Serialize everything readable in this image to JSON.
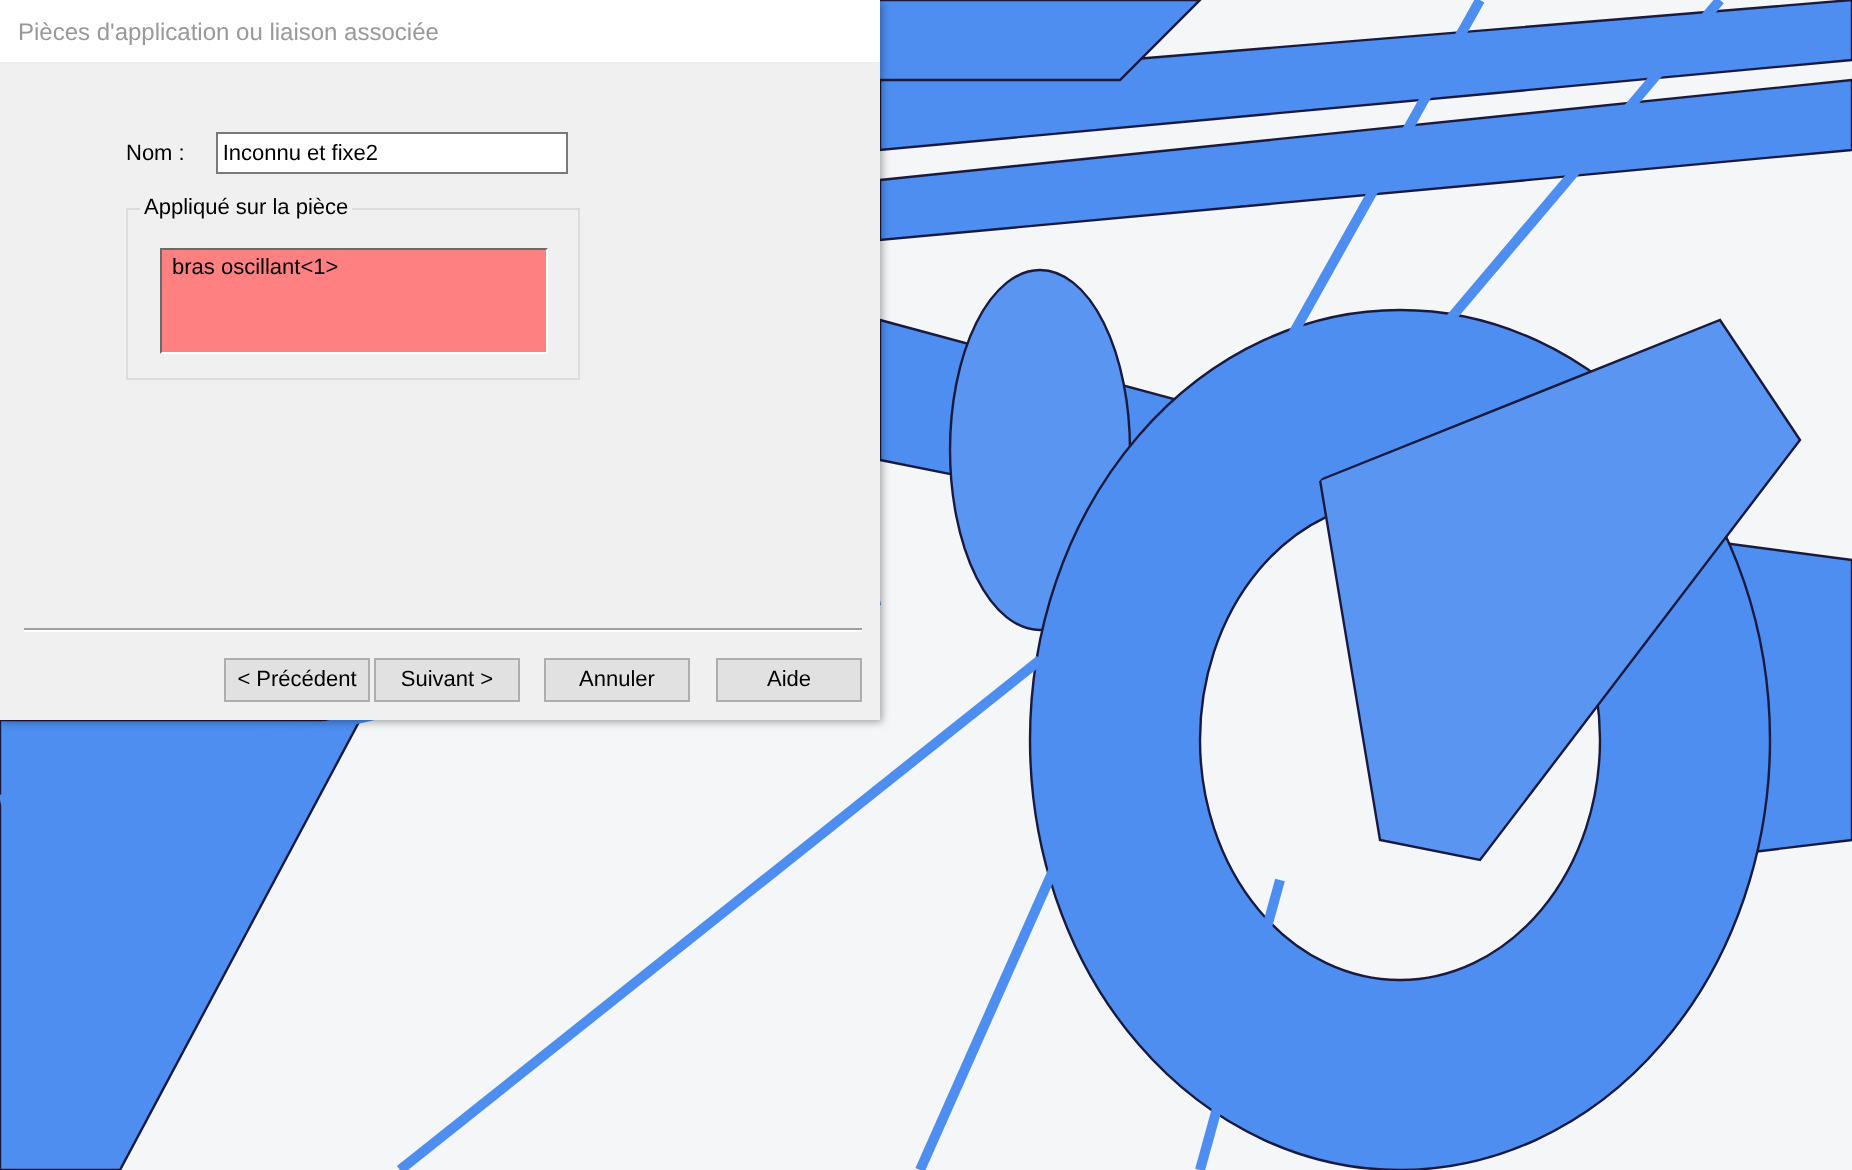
{
  "dialog": {
    "title": "Pièces d'application ou liaison associée",
    "name_field": {
      "label": "Nom :",
      "value": "Inconnu et fixe2"
    },
    "group": {
      "legend": "Appliqué sur la pièce",
      "items": [
        "bras oscillant<1>"
      ]
    },
    "buttons": [
      "< Précédent",
      "Suivant >",
      "Annuler",
      "Aide"
    ]
  }
}
